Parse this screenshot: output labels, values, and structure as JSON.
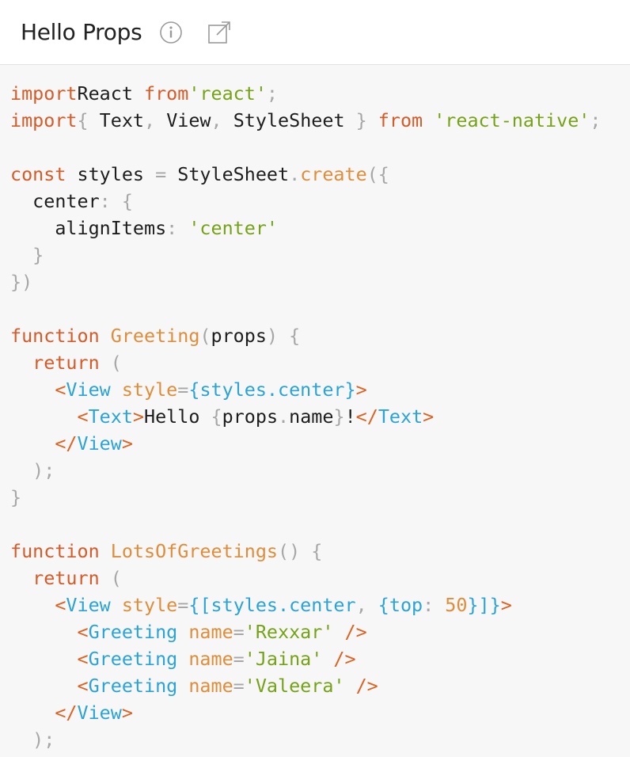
{
  "header": {
    "title": "Hello Props",
    "info_icon": "info-circle-icon",
    "open_icon": "external-link-icon"
  },
  "colors": {
    "keyword": "#d75a27",
    "string": "#76a216",
    "function": "#e08d3a",
    "tag": "#2aa3d8",
    "punctuation": "#a7a7a7",
    "background": "#f7f7f7"
  },
  "code": {
    "lines": [
      [
        [
          "kw",
          "import"
        ],
        [
          "",
          "React "
        ],
        [
          "kw",
          "from"
        ],
        [
          "str",
          "'react'"
        ],
        [
          "punc",
          ";"
        ]
      ],
      [
        [
          "kw",
          "import"
        ],
        [
          "punc",
          "{ "
        ],
        [
          "",
          "Text"
        ],
        [
          "punc",
          ", "
        ],
        [
          "",
          "View"
        ],
        [
          "punc",
          ", "
        ],
        [
          "",
          "StyleSheet "
        ],
        [
          "punc",
          "}"
        ],
        [
          "kw",
          " from "
        ],
        [
          "str",
          "'react-native'"
        ],
        [
          "punc",
          ";"
        ]
      ],
      [],
      [
        [
          "kw",
          "const"
        ],
        [
          "",
          " styles "
        ],
        [
          "punc",
          "= "
        ],
        [
          "",
          "StyleSheet"
        ],
        [
          "punc",
          "."
        ],
        [
          "fn",
          "create"
        ],
        [
          "punc",
          "({"
        ]
      ],
      [
        [
          "",
          "  center"
        ],
        [
          "punc",
          ": {"
        ]
      ],
      [
        [
          "",
          "    alignItems"
        ],
        [
          "punc",
          ": "
        ],
        [
          "str",
          "'center'"
        ]
      ],
      [
        [
          "punc",
          "  }"
        ]
      ],
      [
        [
          "punc",
          "})"
        ]
      ],
      [],
      [
        [
          "kw",
          "function"
        ],
        [
          "fn",
          " Greeting"
        ],
        [
          "punc",
          "("
        ],
        [
          "",
          "props"
        ],
        [
          "punc",
          ") {"
        ]
      ],
      [
        [
          "kw",
          "  return"
        ],
        [
          "punc",
          " ("
        ]
      ],
      [
        [
          "br",
          "    <"
        ],
        [
          "tag",
          "View"
        ],
        [
          "attr",
          " style"
        ],
        [
          "punc",
          "="
        ],
        [
          "tag",
          "{styles.center}"
        ],
        [
          "br",
          ">"
        ]
      ],
      [
        [
          "br",
          "      <"
        ],
        [
          "tag",
          "Text"
        ],
        [
          "br",
          ">"
        ],
        [
          "",
          "Hello "
        ],
        [
          "punc",
          "{"
        ],
        [
          "",
          "props"
        ],
        [
          "punc",
          "."
        ],
        [
          "",
          "name"
        ],
        [
          "punc",
          "}"
        ],
        [
          "",
          "!"
        ],
        [
          "br",
          "</"
        ],
        [
          "tag",
          "Text"
        ],
        [
          "br",
          ">"
        ]
      ],
      [
        [
          "br",
          "    </"
        ],
        [
          "tag",
          "View"
        ],
        [
          "br",
          ">"
        ]
      ],
      [
        [
          "punc",
          "  );"
        ]
      ],
      [
        [
          "punc",
          "}"
        ]
      ],
      [],
      [
        [
          "kw",
          "function"
        ],
        [
          "fn",
          " LotsOfGreetings"
        ],
        [
          "punc",
          "() {"
        ]
      ],
      [
        [
          "kw",
          "  return"
        ],
        [
          "punc",
          " ("
        ]
      ],
      [
        [
          "br",
          "    <"
        ],
        [
          "tag",
          "View"
        ],
        [
          "attr",
          " style"
        ],
        [
          "punc",
          "="
        ],
        [
          "tag",
          "{[styles.center"
        ],
        [
          "punc",
          ", "
        ],
        [
          "tag",
          "{top"
        ],
        [
          "punc",
          ": "
        ],
        [
          "num",
          "50"
        ],
        [
          "tag",
          "}]}"
        ],
        [
          "br",
          ">"
        ]
      ],
      [
        [
          "br",
          "      <"
        ],
        [
          "tag",
          "Greeting"
        ],
        [
          "attr",
          " name"
        ],
        [
          "punc",
          "="
        ],
        [
          "str",
          "'Rexxar'"
        ],
        [
          "br",
          " />"
        ]
      ],
      [
        [
          "br",
          "      <"
        ],
        [
          "tag",
          "Greeting"
        ],
        [
          "attr",
          " name"
        ],
        [
          "punc",
          "="
        ],
        [
          "str",
          "'Jaina'"
        ],
        [
          "br",
          " />"
        ]
      ],
      [
        [
          "br",
          "      <"
        ],
        [
          "tag",
          "Greeting"
        ],
        [
          "attr",
          " name"
        ],
        [
          "punc",
          "="
        ],
        [
          "str",
          "'Valeera'"
        ],
        [
          "br",
          " />"
        ]
      ],
      [
        [
          "br",
          "    </"
        ],
        [
          "tag",
          "View"
        ],
        [
          "br",
          ">"
        ]
      ],
      [
        [
          "punc",
          "  );"
        ]
      ]
    ]
  }
}
